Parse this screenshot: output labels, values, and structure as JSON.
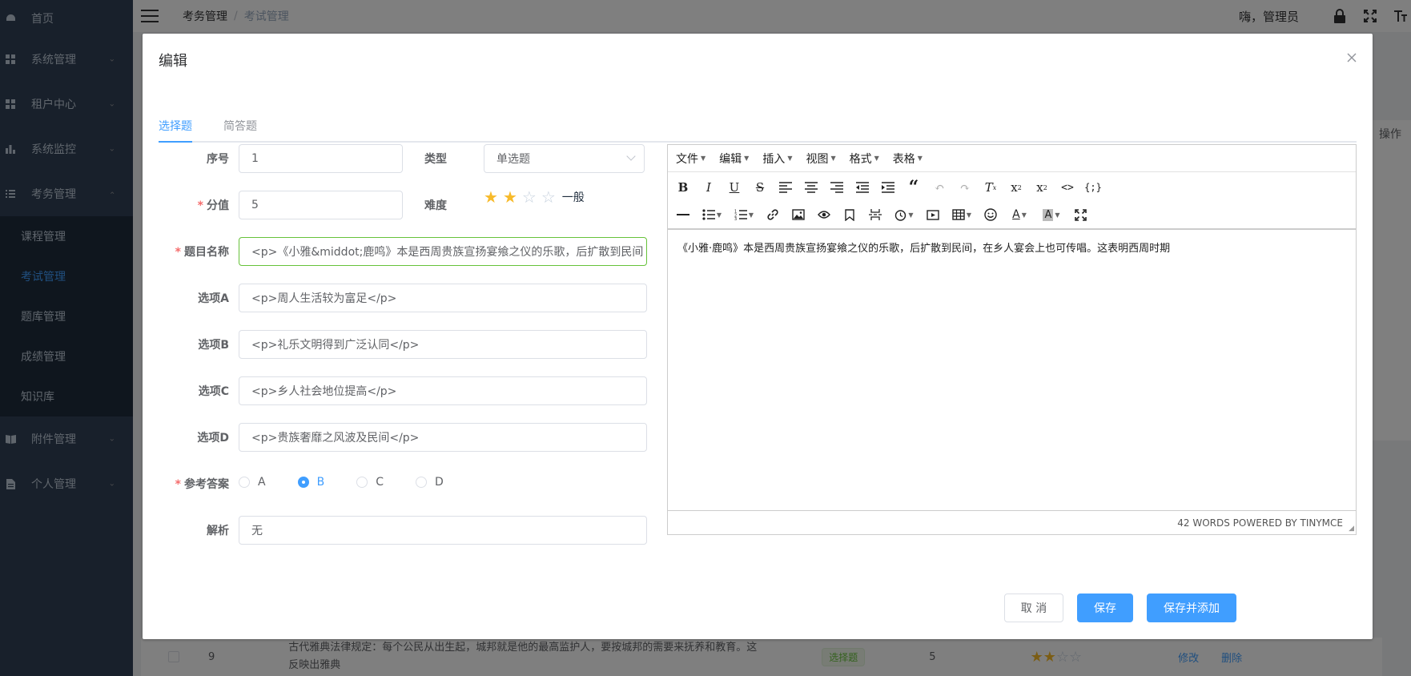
{
  "sidebar": {
    "items": [
      {
        "label": "首页",
        "icon": "dashboard-icon"
      },
      {
        "label": "系统管理",
        "icon": "grid-icon"
      },
      {
        "label": "租户中心",
        "icon": "grid-icon"
      },
      {
        "label": "系统监控",
        "icon": "bar-chart-icon"
      },
      {
        "label": "考务管理",
        "icon": "list-icon"
      }
    ],
    "submenu": [
      "课程管理",
      "考试管理",
      "题库管理",
      "成绩管理",
      "知识库"
    ],
    "bottom_items": [
      {
        "label": "附件管理",
        "icon": "book-icon"
      },
      {
        "label": "个人管理",
        "icon": "document-icon"
      }
    ]
  },
  "header": {
    "breadcrumb": [
      "考务管理",
      "考试管理"
    ],
    "separator": "/",
    "greeting": "嗨，管理员"
  },
  "background": {
    "ops_header": "操作",
    "row": {
      "index": "9",
      "text_line1": "古代雅典法律规定：每个公民从出生起，城邦就是他的最高监护人，要按城邦的需要来抚养和教育。这",
      "text_line2": "反映出雅典",
      "type_tag": "选择题",
      "score": "5",
      "edit": "修改",
      "delete": "删除"
    }
  },
  "dialog": {
    "title": "编辑",
    "tabs": [
      "选择题",
      "简答题"
    ],
    "fields": {
      "index_label": "序号",
      "index_value": "1",
      "type_label": "类型",
      "type_value": "单选题",
      "score_label": "分值",
      "score_value": "5",
      "difficulty_label": "难度",
      "difficulty_text": "一般",
      "difficulty_stars": 2,
      "difficulty_max": 4,
      "title_label": "题目名称",
      "title_value": "<p>《小雅&middot;鹿鸣》本是西周贵族宣扬宴飨之仪的乐歌，后扩散到民间",
      "option_a_label": "选项A",
      "option_a_value": "<p>周人生活较为富足</p>",
      "option_b_label": "选项B",
      "option_b_value": "<p>礼乐文明得到广泛认同</p>",
      "option_c_label": "选项C",
      "option_c_value": "<p>乡人社会地位提高</p>",
      "option_d_label": "选项D",
      "option_d_value": "<p>贵族奢靡之风波及民间</p>",
      "answer_label": "参考答案",
      "answer_options": [
        "A",
        "B",
        "C",
        "D"
      ],
      "answer_selected": "B",
      "analysis_label": "解析",
      "analysis_value": "无"
    },
    "editor": {
      "menus": [
        "文件",
        "编辑",
        "插入",
        "视图",
        "格式",
        "表格"
      ],
      "content": "《小雅·鹿鸣》本是西周贵族宣扬宴飨之仪的乐歌，后扩散到民间，在乡人宴会上也可传唱。这表明西周时期",
      "status": "42 WORDS POWERED BY TINYMCE"
    },
    "buttons": {
      "cancel": "取 消",
      "save": "保存",
      "save_add": "保存并添加"
    }
  }
}
